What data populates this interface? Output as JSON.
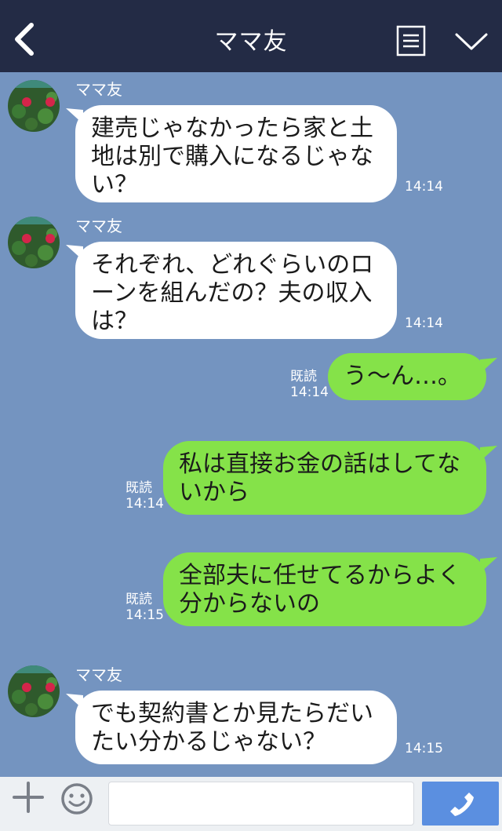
{
  "header": {
    "title": "ママ友"
  },
  "messages": [
    {
      "sender": "ママ友",
      "text": "建売じゃなかったら家と土地は別で購入になるじゃない？",
      "time": "14:14"
    },
    {
      "sender": "ママ友",
      "text": "それぞれ、どれぐらいのローンを組んだの？夫の収入は？",
      "time": "14:14"
    },
    {
      "read": "既読",
      "text": "う〜ん…。",
      "time": "14:14"
    },
    {
      "read": "既読",
      "text": "私は直接お金の話はしてないから",
      "time": "14:14"
    },
    {
      "read": "既読",
      "text": "全部夫に任せてるからよく分からないの",
      "time": "14:15"
    },
    {
      "sender": "ママ友",
      "text": "でも契約書とか見たらだいたい分かるじゃない？",
      "time": "14:15"
    }
  ],
  "colors": {
    "header": "#232b45",
    "background": "#7494c0",
    "incoming_bubble": "#ffffff",
    "outgoing_bubble": "#85e249",
    "call_button": "#5b8fe0"
  },
  "footer": {
    "input_value": ""
  }
}
